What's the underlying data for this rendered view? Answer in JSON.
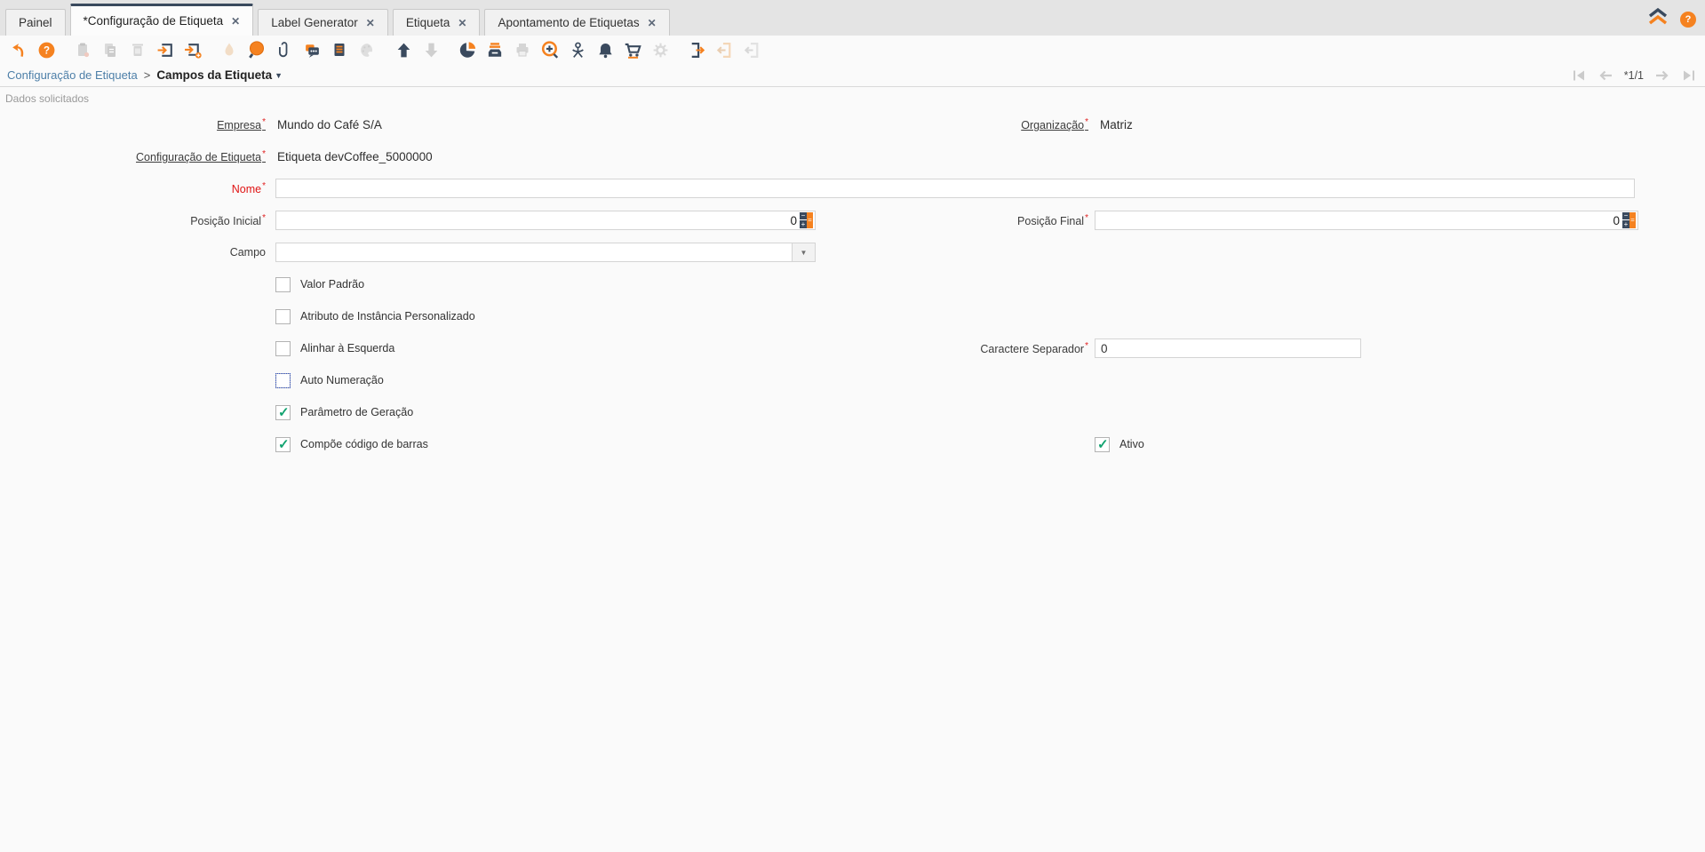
{
  "colors": {
    "accent_orange": "#f58220",
    "navy": "#3a4a5e",
    "link_blue": "#4d7fa8",
    "mandatory_red": "#e01414",
    "check_green": "#12a370"
  },
  "tabs": [
    {
      "label": "Painel",
      "closable": false,
      "active": false
    },
    {
      "label": "*Configuração de Etiqueta",
      "closable": true,
      "active": true
    },
    {
      "label": "Label Generator",
      "closable": true,
      "active": false
    },
    {
      "label": "Etiqueta",
      "closable": true,
      "active": false
    },
    {
      "label": "Apontamento de Etiquetas",
      "closable": true,
      "active": false
    }
  ],
  "toolbar": {
    "items": [
      {
        "name": "undo",
        "enabled": true
      },
      {
        "name": "help",
        "enabled": true
      },
      {
        "name": "new-record",
        "enabled": false
      },
      {
        "name": "copy-record",
        "enabled": false
      },
      {
        "name": "delete-record",
        "enabled": false
      },
      {
        "name": "save",
        "enabled": true
      },
      {
        "name": "save-create",
        "enabled": true
      },
      {
        "name": "requery",
        "enabled": false
      },
      {
        "name": "find",
        "enabled": true
      },
      {
        "name": "attachment",
        "enabled": true
      },
      {
        "name": "chat",
        "enabled": true
      },
      {
        "name": "report",
        "enabled": true
      },
      {
        "name": "customize",
        "enabled": false
      },
      {
        "name": "parent-record",
        "enabled": true
      },
      {
        "name": "detail-record",
        "enabled": false
      },
      {
        "name": "chart",
        "enabled": true
      },
      {
        "name": "archive",
        "enabled": true
      },
      {
        "name": "print",
        "enabled": false
      },
      {
        "name": "zoom-across",
        "enabled": true
      },
      {
        "name": "workflow",
        "enabled": true
      },
      {
        "name": "requests",
        "enabled": true
      },
      {
        "name": "product-info",
        "enabled": true
      },
      {
        "name": "process",
        "enabled": false
      },
      {
        "name": "export",
        "enabled": true
      },
      {
        "name": "import",
        "enabled": false
      },
      {
        "name": "file-import",
        "enabled": false
      }
    ]
  },
  "breadcrumb": {
    "parent": "Configuração de Etiqueta",
    "separator": ">",
    "current": "Campos da Etiqueta"
  },
  "recnav": {
    "indicator": "*1/1"
  },
  "group_label": "Dados solicitados",
  "form": {
    "empresa": {
      "label": "Empresa",
      "value": "Mundo do Café S/A"
    },
    "organizacao": {
      "label": "Organização",
      "value": "Matriz"
    },
    "configuracao_etiqueta": {
      "label": "Configuração de Etiqueta",
      "value": "Etiqueta devCoffee_5000000"
    },
    "nome": {
      "label": "Nome",
      "value": ""
    },
    "posicao_inicial": {
      "label": "Posição Inicial",
      "value": "0"
    },
    "posicao_final": {
      "label": "Posição Final",
      "value": "0"
    },
    "campo": {
      "label": "Campo",
      "value": ""
    },
    "caractere_separador": {
      "label": "Caractere Separador",
      "value": "0"
    },
    "checkboxes": {
      "valor_padrao": {
        "label": "Valor Padrão",
        "checked": false
      },
      "atributo_instancia": {
        "label": "Atributo de Instância Personalizado",
        "checked": false
      },
      "alinhar_esquerda": {
        "label": "Alinhar à Esquerda",
        "checked": false
      },
      "auto_numeracao": {
        "label": "Auto Numeração",
        "checked": false
      },
      "parametro_geracao": {
        "label": "Parâmetro de Geração",
        "checked": true
      },
      "compoe_codigo": {
        "label": "Compõe código de barras",
        "checked": true
      },
      "ativo": {
        "label": "Ativo",
        "checked": true
      }
    }
  }
}
